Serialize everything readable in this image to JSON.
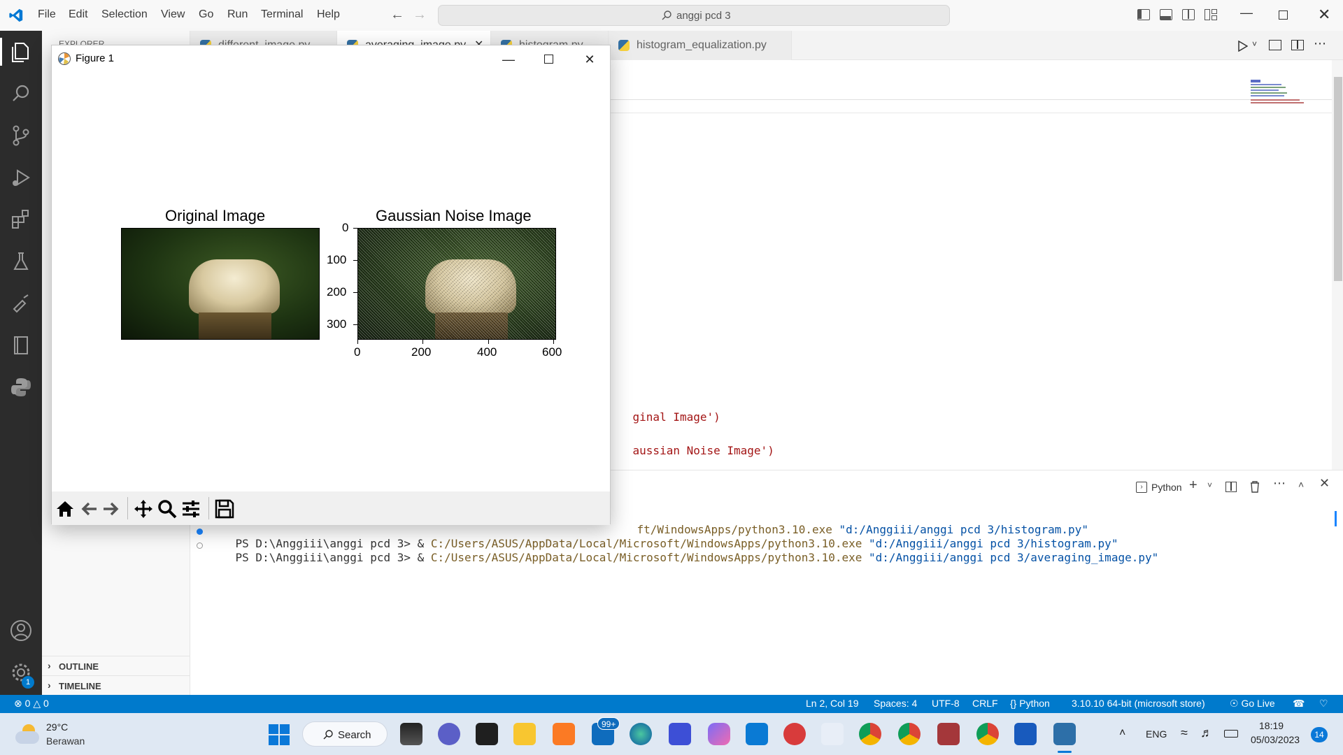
{
  "titlebar": {
    "menu": [
      "File",
      "Edit",
      "Selection",
      "View",
      "Go",
      "Run",
      "Terminal",
      "Help"
    ],
    "search_text": "anggi pcd 3"
  },
  "sidebar": {
    "header": "EXPLORER",
    "outline": "OUTLINE",
    "timeline": "TIMELINE"
  },
  "activity": {
    "settings_badge": "1"
  },
  "tabs": [
    {
      "label": "different_image.py"
    },
    {
      "label": "averaging_image.py"
    },
    {
      "label": "histogram.py"
    },
    {
      "label": "histogram_equalization.py"
    }
  ],
  "editor": {
    "line1_text": "ginal Image')",
    "line2_text": "aussian Noise Image')"
  },
  "panel": {
    "terminal_label": "Python",
    "lines": [
      {
        "prefix": "",
        "cmd_tail": "ft/WindowsApps/python3.10.exe",
        "arg": "\"d:/Anggiii/anggi pcd 3/histogram.py\""
      },
      {
        "prefix": "PS D:\\Anggiii\\anggi pcd 3> & ",
        "path": "C:/Users/ASUS/AppData/Local/Microsoft/WindowsApps/python3.10.exe",
        "arg": "\"d:/Anggiii/anggi pcd 3/histogram.py\""
      },
      {
        "prefix": "PS D:\\Anggiii\\anggi pcd 3> & ",
        "path": "C:/Users/ASUS/AppData/Local/Microsoft/WindowsApps/python3.10.exe",
        "arg": "\"d:/Anggiii/anggi pcd 3/averaging_image.py\""
      }
    ]
  },
  "statusbar": {
    "errors": "0",
    "warnings": "0",
    "position": "Ln 2, Col 19",
    "spaces": "Spaces: 4",
    "encoding": "UTF-8",
    "eol": "CRLF",
    "language": "Python",
    "interpreter": "3.10.10 64-bit (microsoft store)",
    "golive": "Go Live"
  },
  "figure": {
    "title": "Figure 1",
    "left_title": "Original Image",
    "right_title": "Gaussian Noise Image",
    "y_ticks": [
      "0",
      "100",
      "200",
      "300"
    ],
    "x_ticks": [
      "0",
      "200",
      "400",
      "600"
    ]
  },
  "taskbar": {
    "weather_temp": "29°C",
    "weather_desc": "Berawan",
    "search_label": "Search",
    "mail_badge": "99+",
    "lang": "ENG",
    "time": "18:19",
    "date": "05/03/2023",
    "notif_count": "14"
  },
  "colors": {
    "statusbar": "#007acc",
    "activitybar": "#2c2c2c",
    "taskbar": "#dfe8f3",
    "string": "#a31515",
    "terminal_path": "#795e26",
    "terminal_arg": "#0451a5"
  }
}
